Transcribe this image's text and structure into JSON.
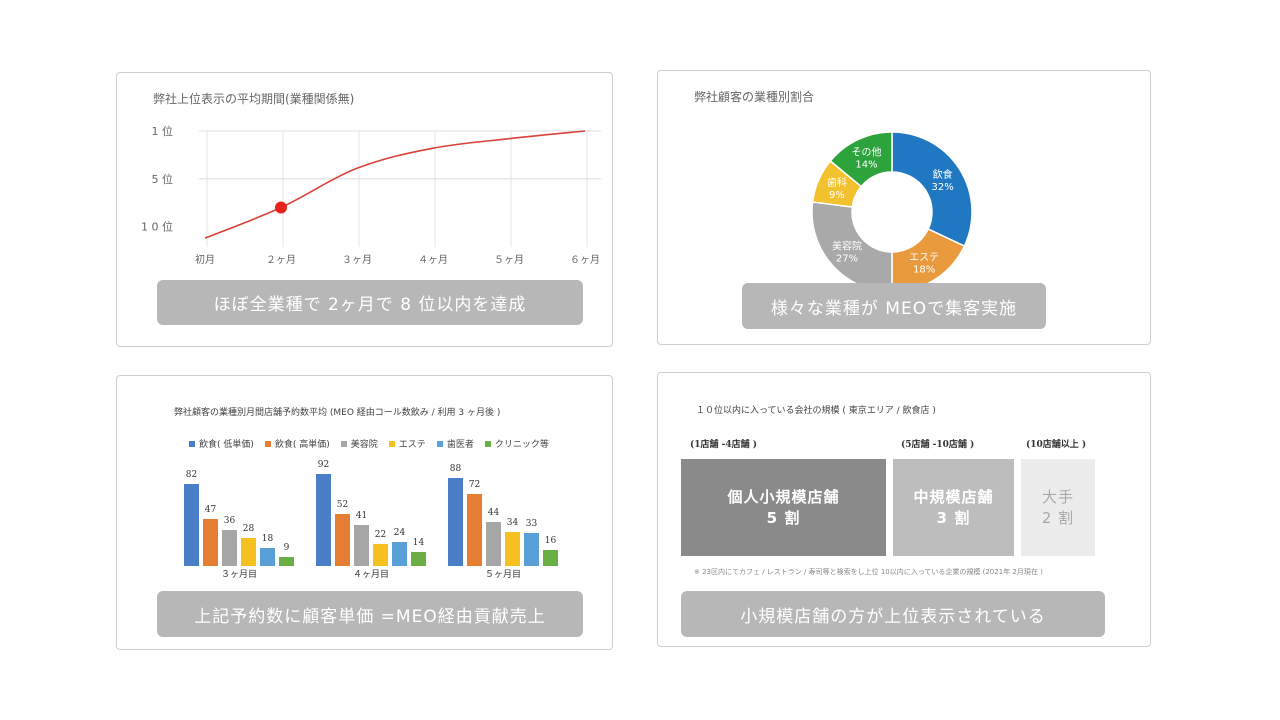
{
  "panel1": {
    "title": "弊社上位表示の平均期間(業種関係無)",
    "pill": "ほぼ全業種で 2ヶ月で 8 位以内を達成"
  },
  "panel2": {
    "title": "弊社顧客の業種別割合",
    "pill": "様々な業種が MEOで集客実施"
  },
  "panel3": {
    "title": "弊社顧客の業種別月間店舗予約数平均 (MEO 経由コール数飲み / 利用 3 ヶ月後 )",
    "pill": "上記予約数に顧客単価 =MEO経由貢献売上"
  },
  "panel4": {
    "title": "１０位以内に入っている会社の規模 ( 東京エリア / 飲食店 )",
    "pill": "小規模店舗の方が上位表示されている",
    "categories": [
      {
        "header": "(1店舗 -4店舗 )",
        "name": "個人小規模店舗",
        "share": "5 割",
        "value": 5,
        "color": "#8a8a8a"
      },
      {
        "header": "(5店舗 -10店舗 )",
        "name": "中規模店舗",
        "share": "3 割",
        "value": 3,
        "color": "#bdbdbd"
      },
      {
        "header": "(10店舗以上 )",
        "name": "大手",
        "share": "2 割",
        "value": 2,
        "color": "#ececec"
      }
    ],
    "note": "※ 23区内にてカフェ / レストラン / 寿司等と検索をし上位 10以内に入っている企業の規模 (2021年 2月現在 )"
  },
  "chart_data": [
    {
      "type": "line",
      "title": "弊社上位表示の平均期間(業種関係無)",
      "x": [
        "初月",
        "２ヶ月",
        "３ヶ月",
        "４ヶ月",
        "５ヶ月",
        "６ヶ月"
      ],
      "series": [
        {
          "values": [
            11.2,
            8.0,
            3.9,
            1.8,
            0.8,
            0.0
          ]
        }
      ],
      "highlight": {
        "x": "２ヶ月",
        "y": 8.0,
        "color": "#e8231b"
      },
      "y_ticks": [
        {
          "value": 0,
          "label": "1 位"
        },
        {
          "value": 5,
          "label": "5 位"
        },
        {
          "value": 10,
          "label": "1 0 位"
        }
      ],
      "ylim": [
        0,
        11.5
      ],
      "y_inverted": true,
      "line_color": "#d9413a",
      "grid": true
    },
    {
      "type": "pie",
      "title": "弊社顧客の業種別割合",
      "donut": true,
      "slices": [
        {
          "name": "飲食",
          "value": 32,
          "label": "32%",
          "color": "#1f78c1"
        },
        {
          "name": "エステ",
          "value": 18,
          "label": "18%",
          "color": "#e89a3c"
        },
        {
          "name": "美容院",
          "value": 27,
          "label": "27%",
          "color": "#a9a9a9"
        },
        {
          "name": "歯科",
          "value": 9,
          "label": "9%",
          "color": "#f2c12e"
        },
        {
          "name": "その他",
          "value": 14,
          "label": "14%",
          "color": "#2ca33b"
        }
      ]
    },
    {
      "type": "bar",
      "title": "弊社顧客の業種別月間店舗予約数平均 (MEO 経由コール数飲み / 利用 3 ヶ月後 )",
      "categories": [
        "３ヶ月目",
        "４ヶ月目",
        "５ヶ月目"
      ],
      "series": [
        {
          "name": "飲食( 低単価)",
          "color": "#4a7ec7",
          "values": [
            82,
            92,
            88
          ]
        },
        {
          "name": "飲食( 高単価)",
          "color": "#e57e33",
          "values": [
            47,
            52,
            72
          ]
        },
        {
          "name": "美容院",
          "color": "#a6a6a6",
          "values": [
            36,
            41,
            44
          ]
        },
        {
          "name": "エステ",
          "color": "#f5c020",
          "values": [
            28,
            22,
            34
          ]
        },
        {
          "name": "歯医者",
          "color": "#5aa0d8",
          "values": [
            18,
            24,
            33
          ]
        },
        {
          "name": "クリニック等",
          "color": "#6aae45",
          "values": [
            9,
            14,
            16
          ]
        }
      ],
      "ylim": [
        0,
        100
      ]
    }
  ]
}
